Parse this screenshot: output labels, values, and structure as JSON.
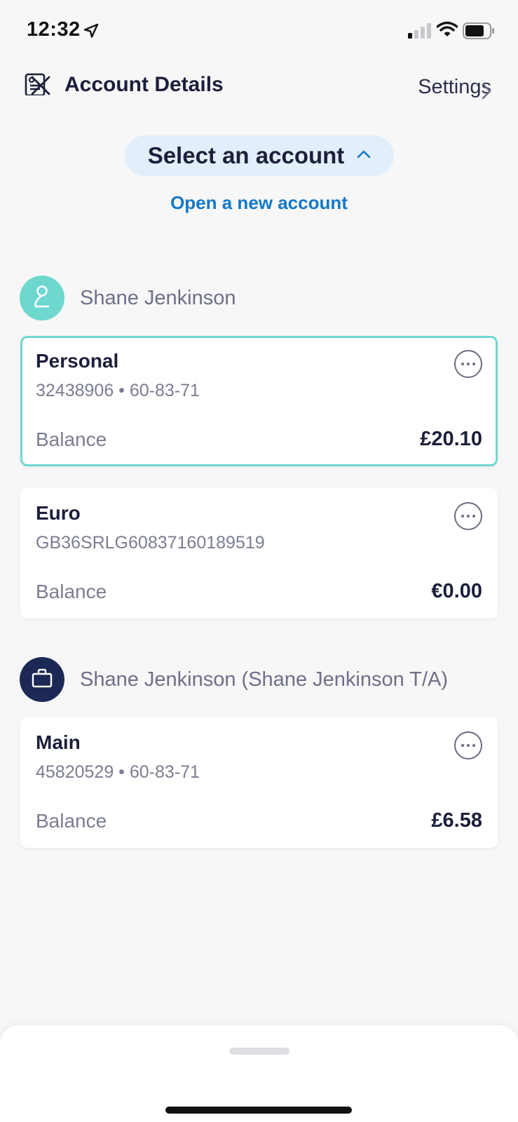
{
  "status_bar": {
    "time": "12:32"
  },
  "nav": {
    "settings_label": "Settings"
  },
  "account_selector": {
    "title": "Select an account",
    "open_new_label": "Open a new account"
  },
  "groups": [
    {
      "owner": "Shane Jenkinson",
      "accounts": [
        {
          "name": "Personal",
          "number": "32438906 • 60-83-71",
          "balance_label": "Balance",
          "balance": "£20.10",
          "selected": true
        },
        {
          "name": "Euro",
          "number": "GB36SRLG60837160189519",
          "balance_label": "Balance",
          "balance": "€0.00",
          "selected": false
        }
      ]
    },
    {
      "owner": "Shane Jenkinson (Shane Jenkinson T/A)",
      "accounts": [
        {
          "name": "Main",
          "number": "45820529 • 60-83-71",
          "balance_label": "Balance",
          "balance": "£6.58",
          "selected": false
        }
      ]
    }
  ],
  "bottom_sheet": {
    "row_label": "Account Details"
  },
  "colors": {
    "accent_teal": "#6ed8cf",
    "link_blue": "#1578c6",
    "navy": "#1c2954",
    "pill_bg": "#e3eefb"
  },
  "icons": [
    "location-arrow-icon",
    "signal-icon",
    "wifi-icon",
    "battery-icon",
    "close-icon",
    "chevron-up-icon",
    "person-icon",
    "briefcase-icon",
    "more-icon",
    "document-icon",
    "chevron-right-icon"
  ]
}
